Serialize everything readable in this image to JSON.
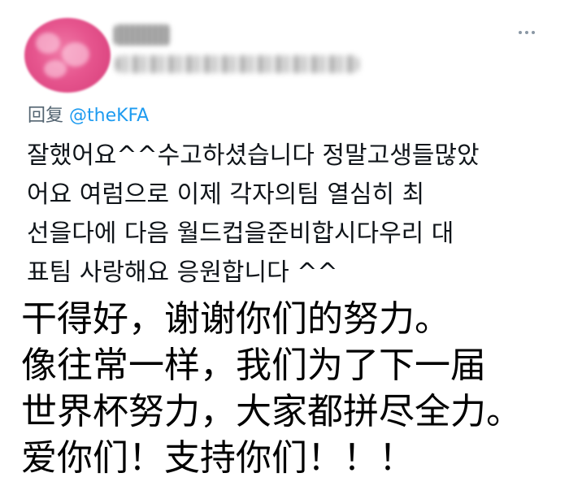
{
  "tweet": {
    "reply_prefix": "回复 ",
    "reply_mention": "@theKFA",
    "korean_lines": [
      "잘했어요^^수고하셨습니다 정말고생들많았",
      "어요    여럼으로 이제 각자의팀  열심히 최",
      "선을다에  다음  월드컵을준비합시다우리 대",
      "표팀 사랑해요 응원합니다 ^^"
    ]
  },
  "translation": {
    "lines": [
      "干得好，谢谢你们的努力。",
      "像往常一样，我们为了下一届",
      "世界杯努力，大家都拼尽全力。",
      "爱你们！支持你们！！！"
    ]
  },
  "icons": {
    "more": "more-horizontal-icon"
  },
  "colors": {
    "mention": "#1d9bf0",
    "muted": "#536471",
    "avatar": "#e6558e"
  }
}
